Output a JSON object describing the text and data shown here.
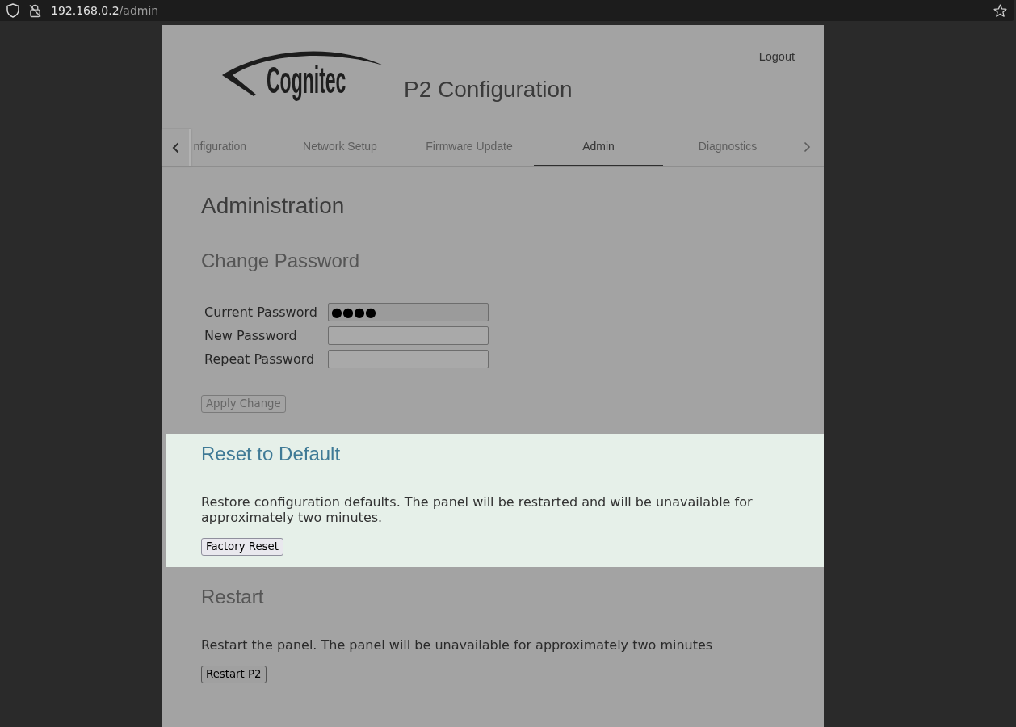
{
  "browser": {
    "url_host": "192.168.0.2",
    "url_path": "/admin"
  },
  "header": {
    "logo_text": "Cognitec",
    "title": "P2 Configuration",
    "logout": "Logout"
  },
  "tabs": [
    {
      "label": "nfiguration",
      "selected": false
    },
    {
      "label": "Network Setup",
      "selected": false
    },
    {
      "label": "Firmware Update",
      "selected": false
    },
    {
      "label": "Admin",
      "selected": true
    },
    {
      "label": "Diagnostics",
      "selected": false
    }
  ],
  "page_title": "Administration",
  "sections": [
    {
      "kind": "form",
      "title": "Change Password",
      "highlighted": false,
      "fields": [
        {
          "label": "Current Password",
          "value": "●●●●",
          "autofilled": true
        },
        {
          "label": "New Password",
          "autofilled": false
        },
        {
          "label": "Repeat Password",
          "autofilled": false
        }
      ],
      "button": {
        "label": "Apply Change",
        "disabled": true
      }
    },
    {
      "kind": "action",
      "title": "Reset to Default",
      "highlighted": true,
      "text": "Restore configuration defaults. The panel will be restarted and will be unavailable for approximately two minutes.",
      "button": {
        "label": "Factory Reset",
        "disabled": false
      }
    },
    {
      "kind": "action",
      "title": "Restart",
      "highlighted": false,
      "text": "Restart the panel. The panel will be unavailable for approximately two minutes",
      "button": {
        "label": "Restart P2",
        "disabled": false
      }
    }
  ]
}
